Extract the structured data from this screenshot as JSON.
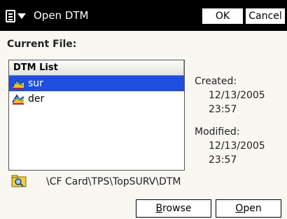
{
  "titlebar": {
    "menu_icon": "menu-grid-icon",
    "title": "Open DTM",
    "ok_label": "OK",
    "cancel_label": "Cancel"
  },
  "current_file": {
    "label": "Current File:"
  },
  "dtm_list": {
    "header": "DTM List",
    "items": [
      {
        "name": "sur",
        "icon": "dtm-surface-icon",
        "selected": true
      },
      {
        "name": "der",
        "icon": "dtm-surface-icon",
        "selected": false
      }
    ]
  },
  "info": {
    "created_label": "Created:",
    "created_date": "12/13/2005",
    "created_time": "23:57",
    "modified_label": "Modified:",
    "modified_date": "12/13/2005",
    "modified_time": "23:57"
  },
  "path": {
    "icon": "folder-search-icon",
    "text": "\\CF Card\\TPS\\TopSURV\\DTM"
  },
  "buttons": {
    "browse_first": "B",
    "browse_rest": "rowse",
    "open_first": "O",
    "open_rest": "pen"
  },
  "colors": {
    "titlebar_bg": "#000000",
    "selection": "#1e4fe0",
    "background": "#f8f7f2"
  }
}
